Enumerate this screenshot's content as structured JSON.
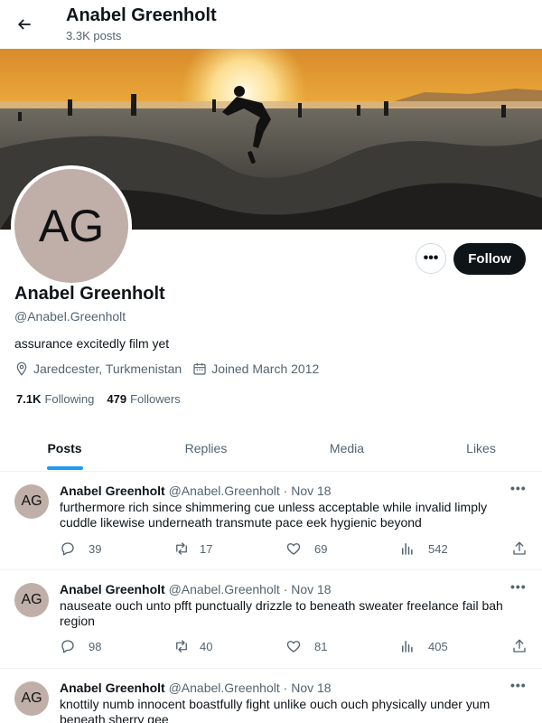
{
  "header": {
    "name": "Anabel Greenholt",
    "post_count": "3.3K posts"
  },
  "profile": {
    "avatar_initials": "AG",
    "name": "Anabel Greenholt",
    "handle": "@Anabel.Greenholt",
    "bio": "assurance excitedly film yet",
    "location": "Jaredcester, Turkmenistan",
    "joined": "Joined March 2012",
    "following_count": "7.1K",
    "following_label": "Following",
    "followers_count": "479",
    "followers_label": "Followers",
    "follow_button": "Follow",
    "more_label": "•••"
  },
  "tabs": [
    {
      "label": "Posts",
      "active": true
    },
    {
      "label": "Replies",
      "active": false
    },
    {
      "label": "Media",
      "active": false
    },
    {
      "label": "Likes",
      "active": false
    }
  ],
  "posts": [
    {
      "initials": "AG",
      "name": "Anabel Greenholt",
      "handle": "@Anabel.Greenholt",
      "sep": "·",
      "date": "Nov 18",
      "text": "furthermore rich since shimmering cue unless acceptable while invalid limply cuddle likewise underneath transmute pace eek hygienic beyond",
      "replies": "39",
      "reposts": "17",
      "likes": "69",
      "views": "542"
    },
    {
      "initials": "AG",
      "name": "Anabel Greenholt",
      "handle": "@Anabel.Greenholt",
      "sep": "·",
      "date": "Nov 18",
      "text": "nauseate ouch unto pfft punctually drizzle to beneath sweater freelance fail bah region",
      "replies": "98",
      "reposts": "40",
      "likes": "81",
      "views": "405"
    },
    {
      "initials": "AG",
      "name": "Anabel Greenholt",
      "handle": "@Anabel.Greenholt",
      "sep": "·",
      "date": "Nov 18",
      "text": "knottily numb innocent boastfully fight unlike ouch ouch physically under yum beneath sherry gee",
      "replies": "",
      "reposts": "",
      "likes": "",
      "views": ""
    }
  ],
  "post_more_label": "•••",
  "colors": {
    "accent": "#1d9bf0",
    "text": "#0f1419",
    "muted": "#536471",
    "avatar_bg": "#c0afa9",
    "follow_bg": "#0f1419"
  },
  "icons": [
    "back-arrow-icon",
    "location-icon",
    "calendar-icon",
    "reply-icon",
    "repost-icon",
    "like-icon",
    "views-icon",
    "share-icon",
    "more-icon"
  ]
}
